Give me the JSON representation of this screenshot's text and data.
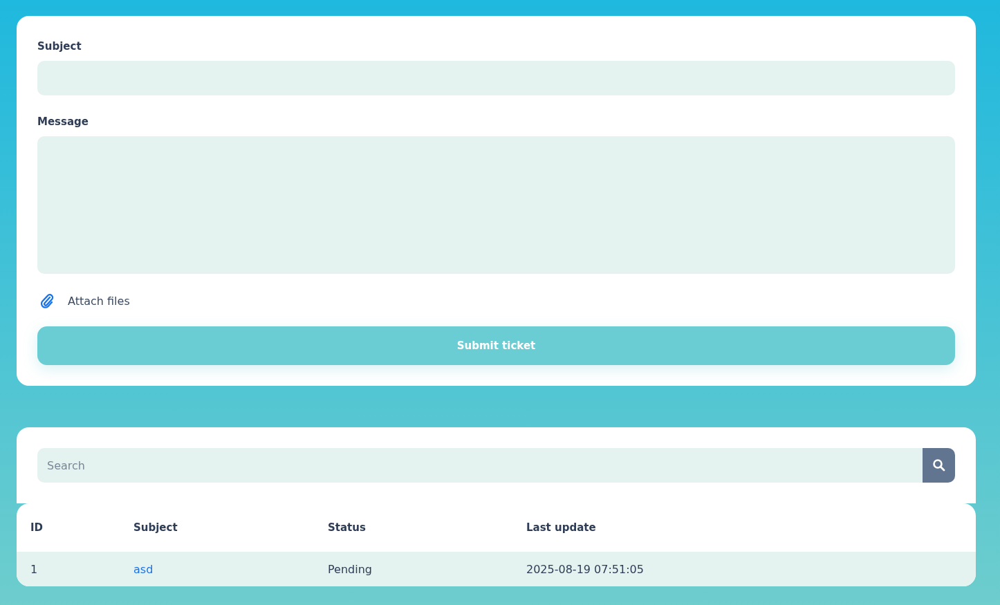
{
  "form": {
    "subject_label": "Subject",
    "message_label": "Message",
    "attach_label": "Attach files",
    "submit": "Submit ticket"
  },
  "search": {
    "placeholder": "Search"
  },
  "table": {
    "columns": [
      "ID",
      "Subject",
      "Status",
      "Last update"
    ],
    "rows": [
      {
        "id": "1",
        "subject": "asd",
        "status": "Pending",
        "updated": "2025-08-19 07:51:05"
      }
    ]
  }
}
